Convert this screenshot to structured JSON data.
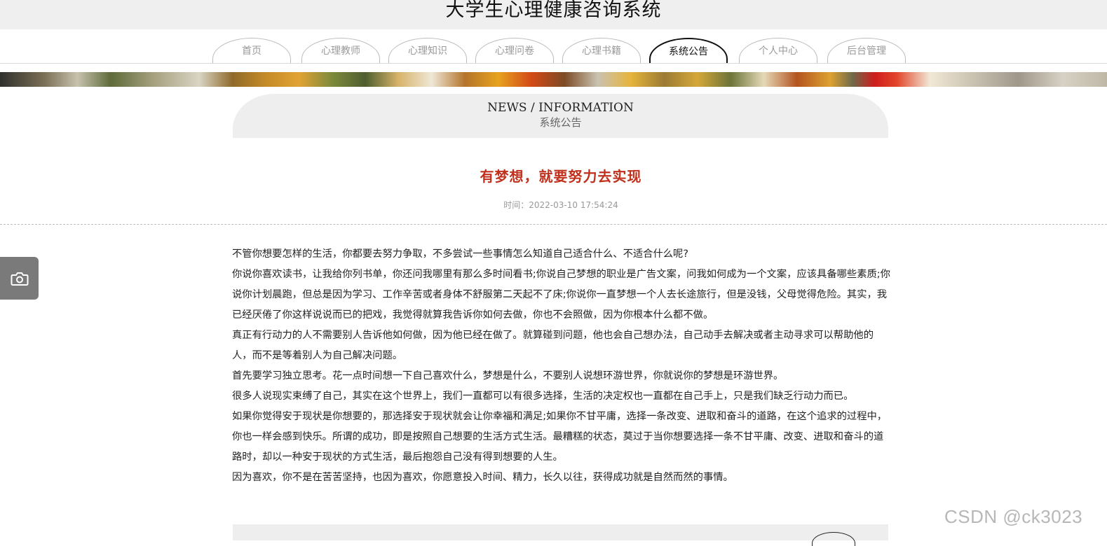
{
  "header": {
    "site_title": "大学生心理健康咨询系统"
  },
  "nav": {
    "tabs": [
      {
        "label": "首页",
        "active": false
      },
      {
        "label": "心理教师",
        "active": false
      },
      {
        "label": "心理知识",
        "active": false
      },
      {
        "label": "心理问卷",
        "active": false
      },
      {
        "label": "心理书籍",
        "active": false
      },
      {
        "label": "系统公告",
        "active": true
      },
      {
        "label": "个人中心",
        "active": false
      },
      {
        "label": "后台管理",
        "active": false
      }
    ]
  },
  "section": {
    "title_en": "NEWS / INFORMATION",
    "title_cn": "系统公告"
  },
  "article": {
    "title": "有梦想，就要努力去实现",
    "time": "时间：2022-03-10 17:54:24",
    "paragraphs": [
      "不管你想要怎样的生活，你都要去努力争取，不多尝试一些事情怎么知道自己适合什么、不适合什么呢?",
      "你说你喜欢读书，让我给你列书单，你还问我哪里有那么多时间看书;你说自己梦想的职业是广告文案，问我如何成为一个文案，应该具备哪些素质;你说你计划晨跑，但总是因为学习、工作辛苦或者身体不舒服第二天起不了床;你说你一直梦想一个人去长途旅行，但是没钱，父母觉得危险。其实，我已经厌倦了你这样说说而已的把戏，我觉得就算我告诉你如何去做，你也不会照做，因为你根本什么都不做。",
      "真正有行动力的人不需要别人告诉他如何做，因为他已经在做了。就算碰到问题，他也会自己想办法，自己动手去解决或者主动寻求可以帮助他的人，而不是等着别人为自己解决问题。",
      "首先要学习独立思考。花一点时间想一下自己喜欢什么，梦想是什么，不要别人说想环游世界，你就说你的梦想是环游世界。",
      "很多人说现实束缚了自己，其实在这个世界上，我们一直都可以有很多选择，生活的决定权也一直都在自己手上，只是我们缺乏行动力而已。",
      "如果你觉得安于现状是你想要的，那选择安于现状就会让你幸福和满足;如果你不甘平庸，选择一条改变、进取和奋斗的道路，在这个追求的过程中，你也一样会感到快乐。所谓的成功，即是按照自己想要的生活方式生活。最糟糕的状态，莫过于当你想要选择一条不甘平庸、改变、进取和奋斗的道路时，却以一种安于现状的方式生活，最后抱怨自己没有得到想要的人生。",
      "因为喜欢，你不是在苦苦坚持，也因为喜欢，你愿意投入时间、精力，长久以往，获得成功就是自然而然的事情。"
    ]
  },
  "camera_button": {
    "icon": "camera-icon"
  },
  "watermark": "CSDN @ck3023"
}
